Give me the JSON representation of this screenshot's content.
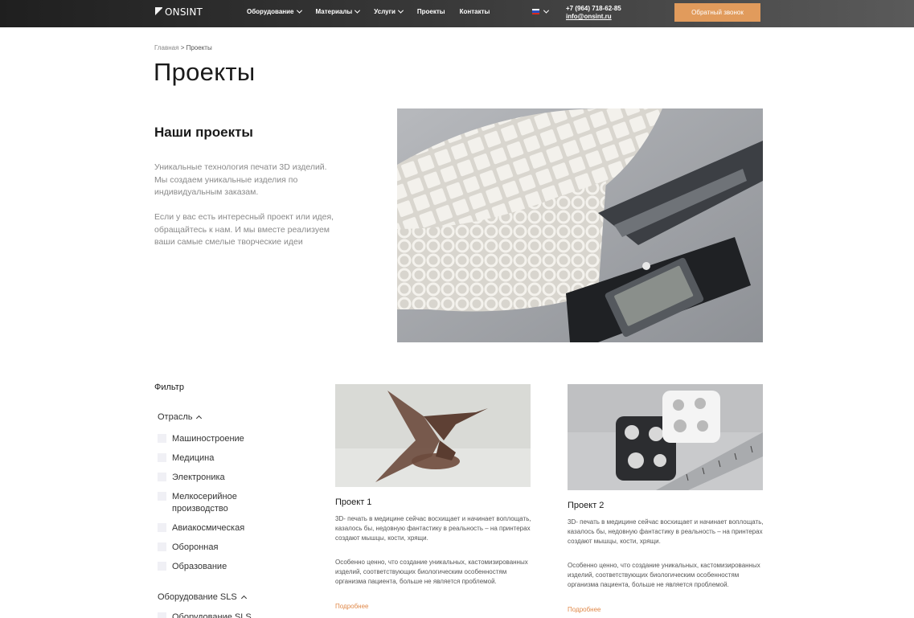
{
  "header": {
    "logo_text": "ONSINT",
    "nav": [
      "Оборудование",
      "Материалы",
      "Услуги",
      "Проекты",
      "Контакты"
    ],
    "phone": "+7 (964) 718-62-85",
    "email": "info@onsint.ru",
    "callback_label": "Обратный звонок"
  },
  "breadcrumb": {
    "home": "Главная",
    "separator": ">",
    "current": "Проекты"
  },
  "page_title": "Проекты",
  "intro": {
    "title": "Наши проекты",
    "p1": "Уникальные технология печати 3D изделий. Мы создаем уникальные изделия по индивидуальным заказам.",
    "p2": "Если у вас есть интересный проект или идея, обращайтесь к нам. И мы вместе реализуем ваши самые смелые творческие идеи"
  },
  "filter": {
    "title": "Фильтр",
    "group1": "Отрасль",
    "items": [
      "Машиностроение",
      "Медицина",
      "Электроника",
      "Мелкосерийное производство",
      "Авиакосмическая",
      "Оборонная",
      "Образование"
    ],
    "group2": "Оборудование SLS",
    "next_item": "Оборудование SLS"
  },
  "projects": [
    {
      "title": "Проект 1",
      "p1": "3D- печать в медицине сейчас восхищает и начинает воплощать, казалось бы, недовную фантастику в реальность – на принтерах создают мышцы, кости, хрящи.",
      "p2": "Особенно ценно, что создание уникальных, кастомизированных изделий, соответствующих биологическим особенностям организма пациента, больше не является проблемой.",
      "more": "Подробнее"
    },
    {
      "title": "Проект 2",
      "p1": "3D- печать в медицине сейчас восхищает и начинает воплощать, казалось бы, недовную фантастику в реальность – на принтерах создают мышцы, кости, хрящи.",
      "p2": "Особенно ценно, что создание уникальных, кастомизированных изделий, соответствующих биологическим особенностям организма пациента, больше не является проблемой.",
      "more": "Подробнее"
    }
  ],
  "colors": {
    "accent": "#e19b5c",
    "link": "#e0894a",
    "header_dark": "#1f1f1f"
  }
}
